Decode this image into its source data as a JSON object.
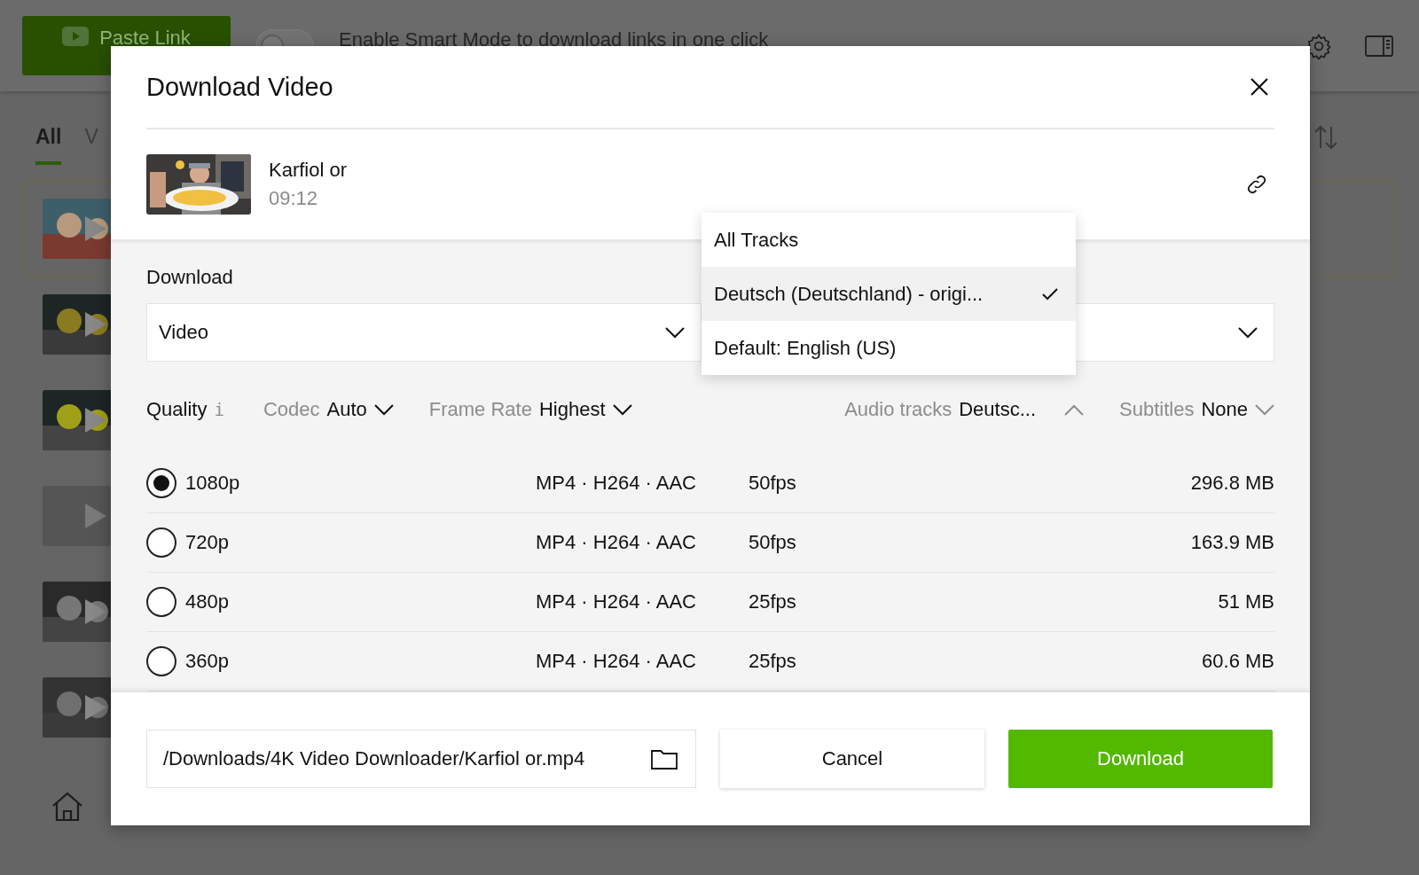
{
  "background": {
    "paste_button": {
      "label": "Paste Link"
    },
    "smart_mode": {
      "on": false,
      "label": "Enable Smart Mode to download links in one click"
    },
    "tabs": [
      {
        "label": "All",
        "selected": true
      },
      {
        "label": "V",
        "selected": false
      }
    ],
    "items": [
      {
        "kind": "picture"
      },
      {
        "kind": "picture"
      },
      {
        "kind": "picture"
      },
      {
        "kind": "placeholder"
      },
      {
        "kind": "picture"
      },
      {
        "kind": "picture"
      }
    ]
  },
  "dialog": {
    "title": "Download Video",
    "media": {
      "title": "Karfiol or",
      "duration": "09:12"
    },
    "download_label": "Download",
    "download_select": {
      "value": "Video"
    },
    "audio_menu": [
      {
        "label": "All Tracks",
        "selected": false
      },
      {
        "label": "Deutsch (Deutschland) - origi...",
        "selected": true
      },
      {
        "label": "Default: English (US)",
        "selected": false
      }
    ],
    "filters": {
      "quality": {
        "label": "Quality",
        "info": "i"
      },
      "codec": {
        "label": "Codec",
        "value": "Auto",
        "expanded": false
      },
      "frame_rate": {
        "label": "Frame Rate",
        "value": "Highest",
        "expanded": false
      },
      "audio_tracks": {
        "label": "Audio tracks",
        "value": "Deutsc...",
        "expanded": true
      },
      "subtitles": {
        "label": "Subtitles",
        "value": "None",
        "expanded": false
      }
    },
    "formats": [
      {
        "resolution": "1080p",
        "format": "MP4 · H264 · AAC",
        "fps": "50fps",
        "size": "296.8 MB",
        "selected": true
      },
      {
        "resolution": "720p",
        "format": "MP4 · H264 · AAC",
        "fps": "50fps",
        "size": "163.9 MB",
        "selected": false
      },
      {
        "resolution": "480p",
        "format": "MP4 · H264 · AAC",
        "fps": "25fps",
        "size": "51 MB",
        "selected": false
      },
      {
        "resolution": "360p",
        "format": "MP4 · H264 · AAC",
        "fps": "25fps",
        "size": "60.6 MB",
        "selected": false
      }
    ],
    "path": "/Downloads/4K Video Downloader/Karfiol or.mp4",
    "cancel": "Cancel",
    "download": "Download"
  }
}
